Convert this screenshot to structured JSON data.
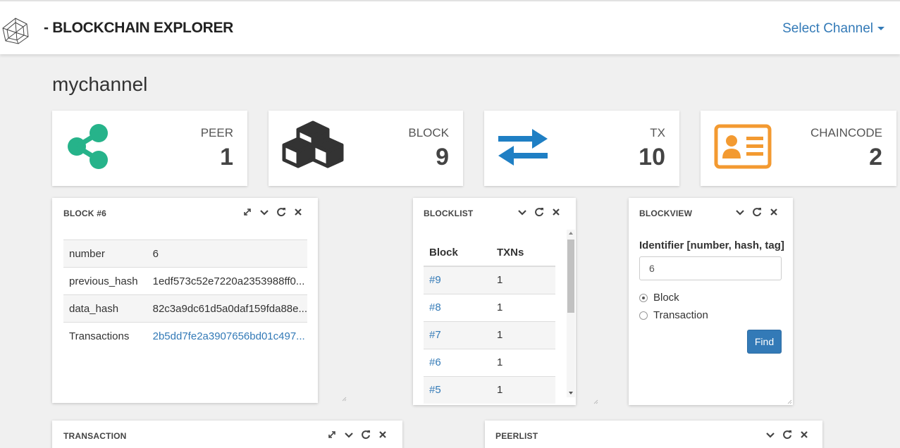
{
  "header": {
    "brand": "- BLOCKCHAIN EXPLORER",
    "select_channel": "Select Channel"
  },
  "channel": {
    "name": "mychannel"
  },
  "stats": [
    {
      "label": "PEER",
      "value": "1",
      "icon": "share-icon",
      "color": "#26b38a"
    },
    {
      "label": "BLOCK",
      "value": "9",
      "icon": "cubes-icon",
      "color": "#333333"
    },
    {
      "label": "TX",
      "value": "10",
      "icon": "exchange-icon",
      "color": "#1f7fc4"
    },
    {
      "label": "CHAINCODE",
      "value": "2",
      "icon": "id-card-icon",
      "color": "#f39a31"
    }
  ],
  "block_panel": {
    "title": "BLOCK #6",
    "rows": [
      {
        "key": "number",
        "value": "6"
      },
      {
        "key": "previous_hash",
        "value": "1edf573c52e7220a2353988ff0..."
      },
      {
        "key": "data_hash",
        "value": "82c3a9dc61d5a0daf159fda88e..."
      },
      {
        "key": "Transactions",
        "value": "2b5dd7fe2a3907656bd01c497..."
      }
    ]
  },
  "blocklist": {
    "title": "BLOCKLIST",
    "headers": [
      "Block",
      "TXNs"
    ],
    "rows": [
      {
        "block": "#9",
        "txns": "1"
      },
      {
        "block": "#8",
        "txns": "1"
      },
      {
        "block": "#7",
        "txns": "1"
      },
      {
        "block": "#6",
        "txns": "1"
      },
      {
        "block": "#5",
        "txns": "1"
      }
    ]
  },
  "blockview": {
    "title": "BLOCKVIEW",
    "identifier_label": "Identifier [number, hash, tag]",
    "identifier_value": "6",
    "radio_block": "Block",
    "radio_transaction": "Transaction",
    "find_label": "Find"
  },
  "transaction_panel": {
    "title": "TRANSACTION"
  },
  "peerlist_panel": {
    "title": "PEERLIST"
  },
  "colors": {
    "link": "#337ab7",
    "primary": "#337ab7",
    "background": "#f0f0f0"
  }
}
